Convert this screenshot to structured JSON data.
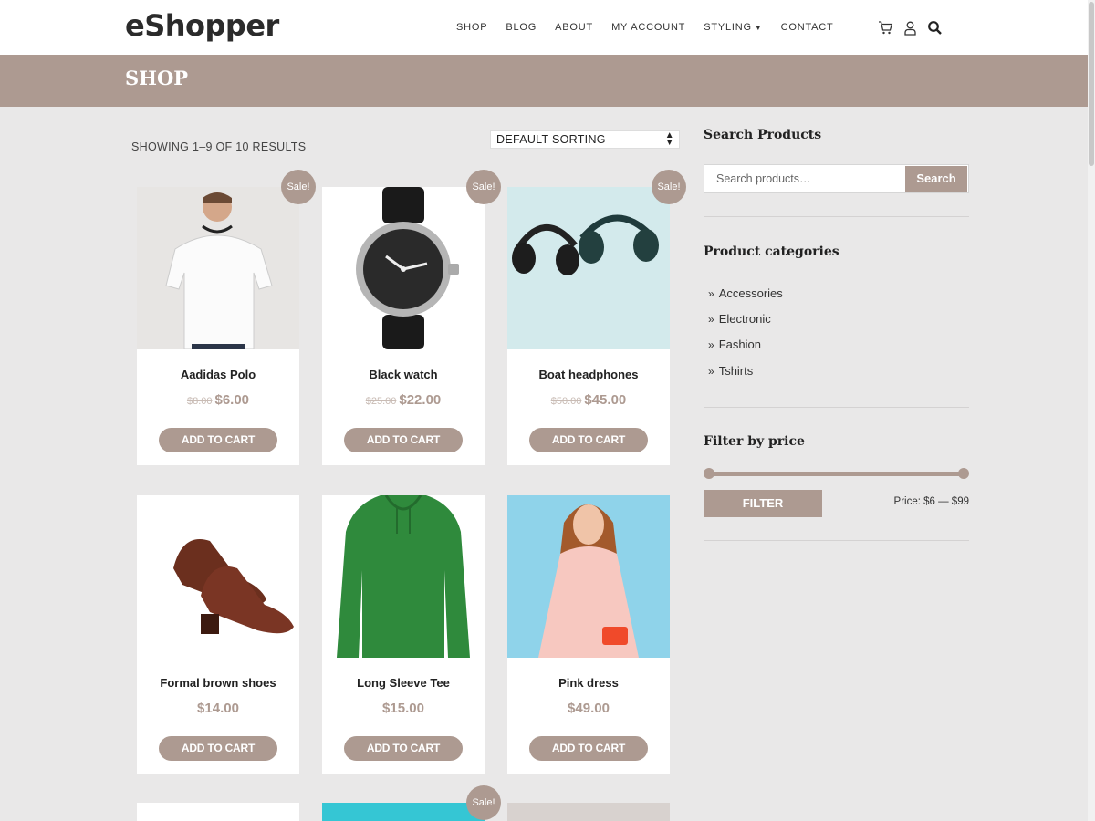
{
  "header": {
    "logo": "eShopper",
    "nav": [
      {
        "label": "SHOP"
      },
      {
        "label": "BLOG"
      },
      {
        "label": "ABOUT"
      },
      {
        "label": "MY ACCOUNT"
      },
      {
        "label": "STYLING"
      },
      {
        "label": "CONTACT"
      }
    ],
    "icons": [
      "cart-icon",
      "user-icon",
      "search-icon"
    ]
  },
  "page": {
    "title": "SHOP",
    "results_text": "SHOWING 1–9 OF 10 RESULTS",
    "sorting_value": "DEFAULT SORTING"
  },
  "products": [
    {
      "name": "Aadidas Polo",
      "old_price": "$8.00",
      "price": "$6.00",
      "sale": "Sale!",
      "button": "ADD TO CART"
    },
    {
      "name": "Black watch",
      "old_price": "$25.00",
      "price": "$22.00",
      "sale": "Sale!",
      "button": "ADD TO CART"
    },
    {
      "name": "Boat headphones",
      "old_price": "$50.00",
      "price": "$45.00",
      "sale": "Sale!",
      "button": "ADD TO CART"
    },
    {
      "name": "Formal brown shoes",
      "old_price": "",
      "price": "$14.00",
      "sale": "",
      "button": "ADD TO CART"
    },
    {
      "name": "Long Sleeve Tee",
      "old_price": "",
      "price": "$15.00",
      "sale": "",
      "button": "ADD TO CART"
    },
    {
      "name": "Pink dress",
      "old_price": "",
      "price": "$49.00",
      "sale": "",
      "button": "ADD TO CART"
    }
  ],
  "partial_row": {
    "sale": "Sale!"
  },
  "sidebar": {
    "search_heading": "Search Products",
    "search_placeholder": "Search products…",
    "search_button": "Search",
    "categories_heading": "Product categories",
    "categories": [
      "Accessories",
      "Electronic",
      "Fashion",
      "Tshirts"
    ],
    "price_heading": "Filter by price",
    "filter_button": "FILTER",
    "price_range": "Price: $6 — $99"
  },
  "colors": {
    "accent": "#ad9a91",
    "background": "#e9e8e8"
  }
}
